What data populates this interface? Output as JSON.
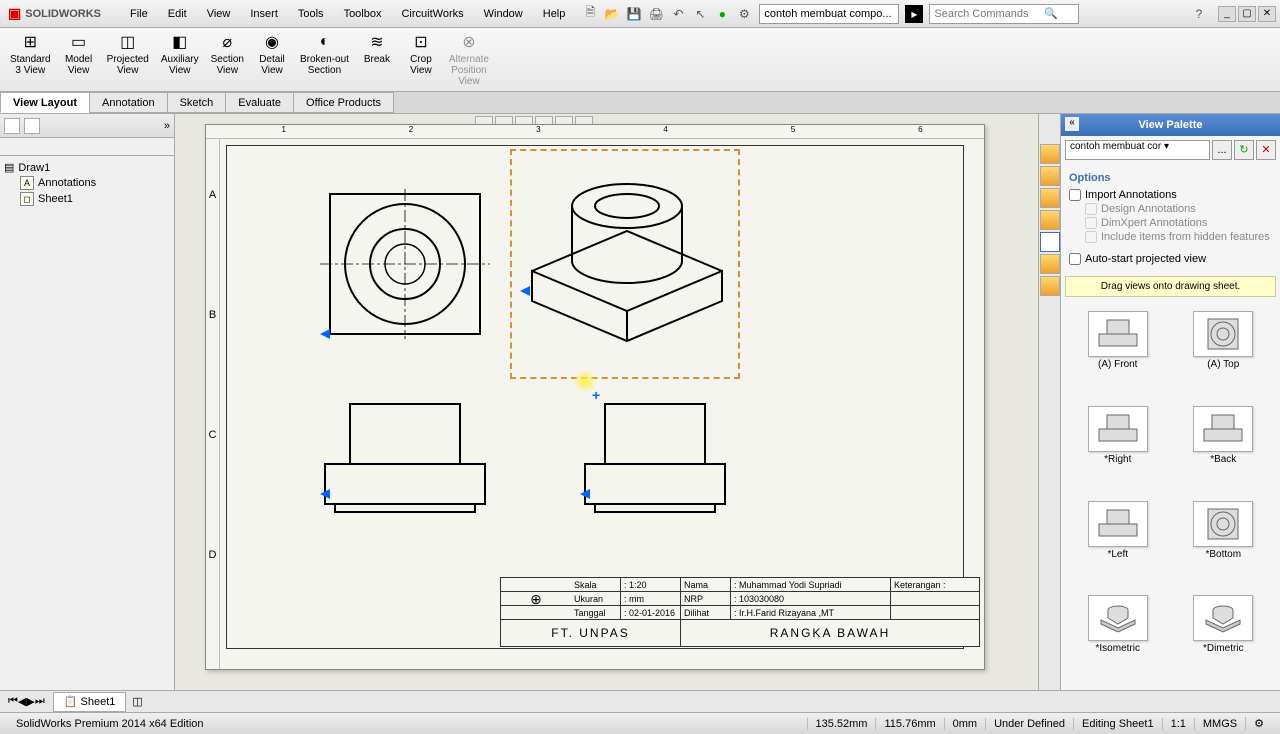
{
  "app": {
    "name": "SOLIDWORKS",
    "doc": "contoh membuat compo..."
  },
  "menu": [
    "File",
    "Edit",
    "View",
    "Insert",
    "Tools",
    "Toolbox",
    "CircuitWorks",
    "Window",
    "Help"
  ],
  "search": {
    "placeholder": "Search Commands"
  },
  "ribbon": [
    {
      "label": "Standard\n3 View",
      "icon": "⊞"
    },
    {
      "label": "Model\nView",
      "icon": "▭"
    },
    {
      "label": "Projected\nView",
      "icon": "◫"
    },
    {
      "label": "Auxiliary\nView",
      "icon": "◧"
    },
    {
      "label": "Section\nView",
      "icon": "⌀"
    },
    {
      "label": "Detail\nView",
      "icon": "◉"
    },
    {
      "label": "Broken-out\nSection",
      "icon": "◐"
    },
    {
      "label": "Break\n ",
      "icon": "≋"
    },
    {
      "label": "Crop\nView",
      "icon": "⊡"
    },
    {
      "label": "Alternate\nPosition\nView",
      "icon": "⊗",
      "disabled": true
    }
  ],
  "tabs": [
    "View Layout",
    "Annotation",
    "Sketch",
    "Evaluate",
    "Office Products"
  ],
  "tree": {
    "root": "Draw1",
    "items": [
      "Annotations",
      "Sheet1"
    ]
  },
  "titleblock": {
    "skala_l": "Skala",
    "skala": "1:20",
    "ukuran_l": "Ukuran",
    "ukuran": "mm",
    "tanggal_l": "Tanggal",
    "tanggal": "02-01-2016",
    "nama_l": "Nama",
    "nama": "Muhammad Yodi Supriadi",
    "nrp_l": "NRP",
    "nrp": "103030080",
    "dilihat_l": "Dilihat",
    "dilihat": "Ir.H.Farid Rizayana ,MT",
    "ket_l": "Keterangan :",
    "org": "FT. UNPAS",
    "title": "RANGKA BAWAH"
  },
  "palette": {
    "title": "View Palette",
    "select": "contoh membuat cor",
    "options_title": "Options",
    "import": "Import Annotations",
    "design": "Design Annotations",
    "dimxpert": "DimXpert Annotations",
    "hidden": "Include items from hidden features",
    "autostart": "Auto-start projected view",
    "hint": "Drag views onto drawing sheet.",
    "items": [
      {
        "label": "(A) Front",
        "kind": "front"
      },
      {
        "label": "(A) Top",
        "kind": "top"
      },
      {
        "label": "*Right",
        "kind": "front"
      },
      {
        "label": "*Back",
        "kind": "front"
      },
      {
        "label": "*Left",
        "kind": "front"
      },
      {
        "label": "*Bottom",
        "kind": "top"
      },
      {
        "label": "*Isometric",
        "kind": "iso"
      },
      {
        "label": "*Dimetric",
        "kind": "iso"
      }
    ]
  },
  "sheet_tab": "Sheet1",
  "status": {
    "edition": "SolidWorks Premium 2014 x64 Edition",
    "x": "135.52mm",
    "y": "115.76mm",
    "z": "0mm",
    "state": "Under Defined",
    "editing": "Editing Sheet1",
    "scale": "1:1",
    "units": "MMGS"
  },
  "rulers": {
    "h": [
      "1",
      "2",
      "3",
      "4",
      "5",
      "6"
    ],
    "v": [
      "A",
      "B",
      "C",
      "D"
    ]
  }
}
